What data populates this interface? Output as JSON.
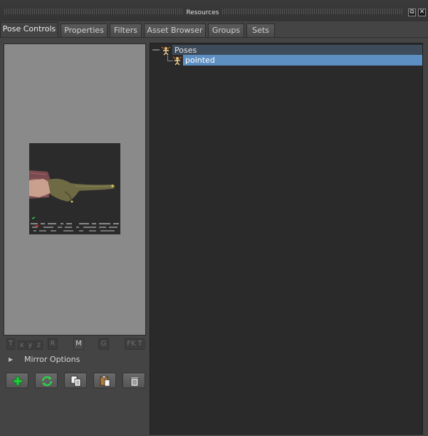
{
  "window": {
    "title": "Resources",
    "float_glyph": "⧉",
    "close_glyph": "✕"
  },
  "tabs": [
    {
      "label": "Pose Controls",
      "active": true
    },
    {
      "label": "Properties",
      "active": false
    },
    {
      "label": "Filters",
      "active": false
    },
    {
      "label": "Asset Browser",
      "active": false
    },
    {
      "label": "Groups",
      "active": false
    },
    {
      "label": "Sets",
      "active": false
    }
  ],
  "preview": {
    "thumbnail": "pointing-hand-pose-thumbnail"
  },
  "axis_buttons": {
    "t": "T",
    "x": "x",
    "y": "y",
    "z": "z",
    "r": "R",
    "m": "M",
    "g": "G",
    "fkt": "FK T"
  },
  "mirror_options": {
    "label": "Mirror Options",
    "arrow": "▶"
  },
  "toolbar_icons": [
    "add-pose-icon",
    "refresh-pose-icon",
    "copy-pose-icon",
    "paste-pose-icon",
    "delete-pose-icon"
  ],
  "tree": {
    "root": {
      "label": "Poses",
      "icon": "poses-folder-icon"
    },
    "items": [
      {
        "label": "pointed",
        "icon": "pose-icon",
        "selected": true
      }
    ]
  },
  "colors": {
    "selection": "#5d8fc3",
    "root_row": "#3e4b5a",
    "add_icon": "#1fd13a",
    "refresh_icon": "#2fd24a"
  }
}
